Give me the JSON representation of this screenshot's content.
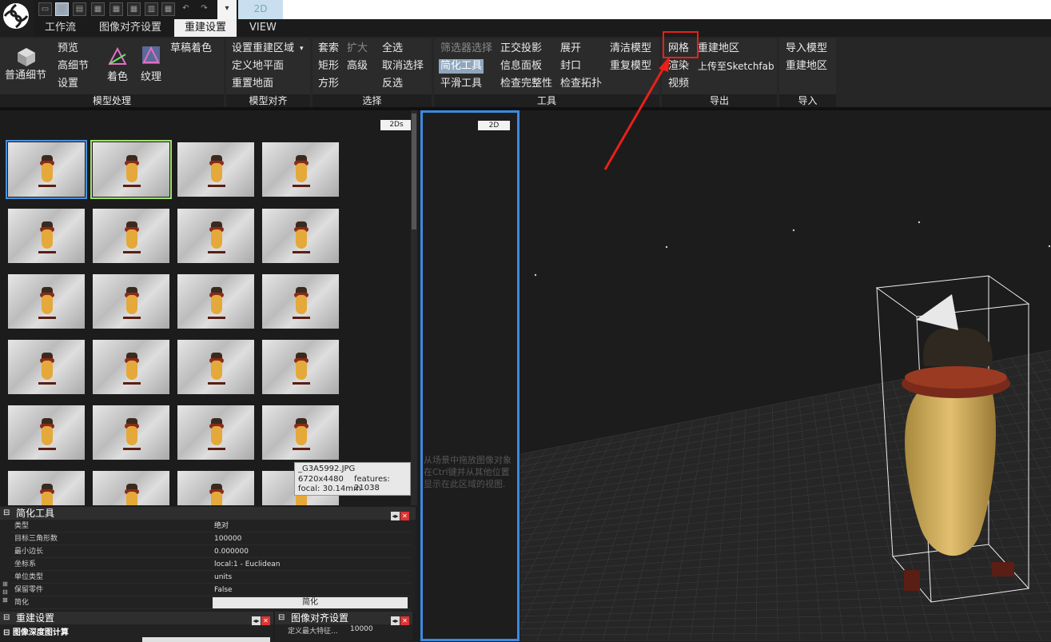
{
  "top": {
    "view_tab": "2D"
  },
  "tabs": [
    "工作流",
    "图像对齐设置",
    "重建设置",
    "VIEW"
  ],
  "ribbon": {
    "model": {
      "label": "模型处理",
      "normal_detail": "普通细节",
      "preview": "预览",
      "high_detail": "高细节",
      "settings": "设置",
      "colorize": "着色",
      "texture": "纹理",
      "draft_color": "草稿着色"
    },
    "align": {
      "label": "模型对齐",
      "set_region": "设置重建区域",
      "define_ground": "定义地平面",
      "reset_ground": "重置地面"
    },
    "select": {
      "label": "选择",
      "lasso": "套索",
      "expand": "扩大",
      "select_all": "全选",
      "rect": "矩形",
      "advanced": "高级",
      "deselect": "取消选择",
      "box": "方形",
      "invert": "反选"
    },
    "tools": {
      "label": "工具",
      "filter_select": "筛选器选择",
      "ortho": "正交投影",
      "unwrap": "展开",
      "clean_model": "清洁模型",
      "simplify": "简化工具",
      "info_panel": "信息面板",
      "close_holes": "封口",
      "duplicate": "重复模型",
      "smooth": "平滑工具",
      "check_integrity": "检查完整性",
      "check_topology": "检查拓扑"
    },
    "export": {
      "label": "导出",
      "mesh": "网格",
      "region": "重建地区",
      "render": "渲染",
      "sketchfab": "上传至Sketchfab",
      "video": "视频"
    },
    "import": {
      "label": "导入",
      "import_model": "导入模型",
      "region": "重建地区"
    }
  },
  "left_panel": {
    "tag": "2Ds",
    "tooltip": {
      "file": "_G3A5992.JPG",
      "size": "6720x4480",
      "features": "features: 21038",
      "focal": "focal: 30.14mm"
    }
  },
  "props": {
    "title": "简化工具",
    "rows": [
      {
        "k": "类型",
        "v": "绝对"
      },
      {
        "k": "目标三角形数",
        "v": "100000"
      },
      {
        "k": "最小边长",
        "v": "0.000000"
      },
      {
        "k": "坐标系",
        "v": "local:1 - Euclidean"
      },
      {
        "k": "单位类型",
        "v": "units"
      },
      {
        "k": "保留零件",
        "v": "False"
      }
    ],
    "action_label": "简化",
    "action_button": "简化"
  },
  "bottom": {
    "recon_title": "重建设置",
    "recon_section": "图像深度图计算",
    "align_title": "图像对齐设置",
    "align_row_k": "定义最大特征...",
    "align_row_v": "10000"
  },
  "mid": {
    "tag": "2D",
    "hint": [
      "从场景中拖放图像对象",
      "在Ctrl键并从其他位置",
      "显示在此区域的视图."
    ]
  },
  "colors": {
    "accent": "#3c8ae0",
    "highlight": "#e8201a"
  }
}
